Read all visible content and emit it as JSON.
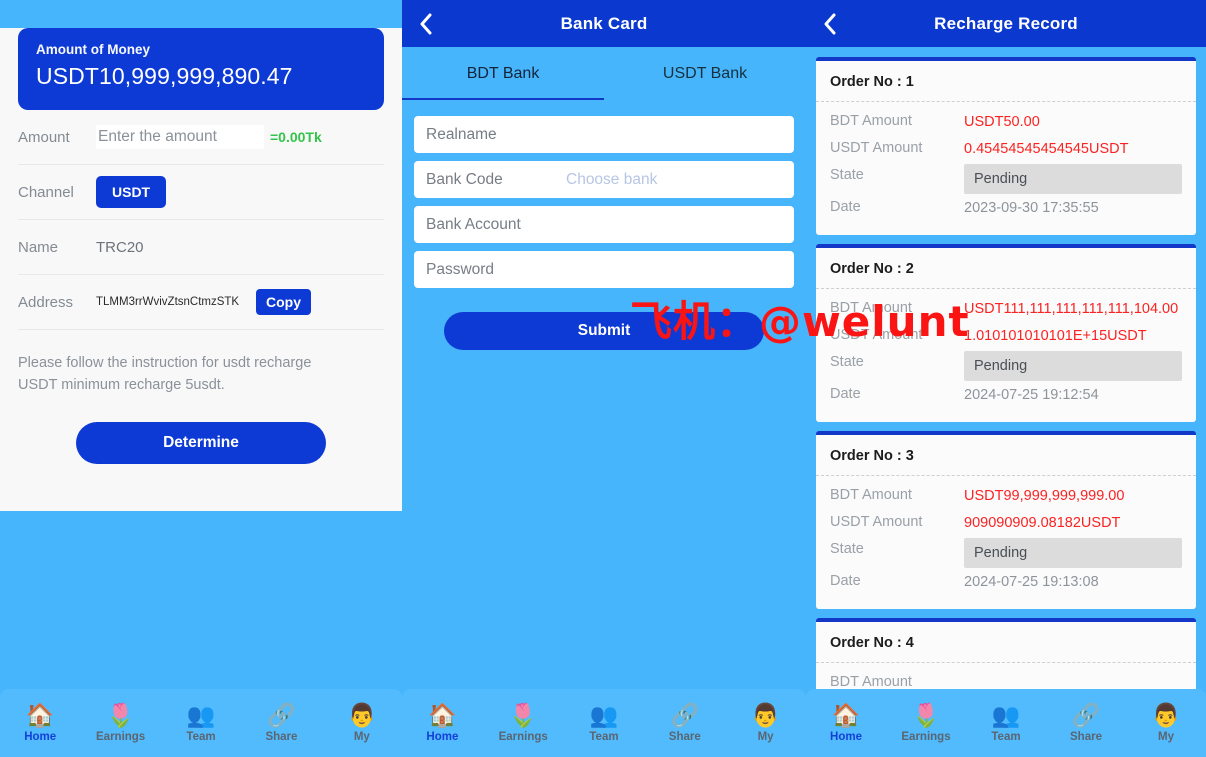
{
  "colors": {
    "brand_blue": "#0d3ad4",
    "light_blue_bg": "#46b5fb",
    "header_blue": "#0b39cf",
    "green_note": "#33c54b",
    "red_amount": "#fb2222",
    "badge_gray": "#dcdcdc",
    "watermark_red": "#fb1414"
  },
  "watermark": {
    "text": "飞机：@welunt"
  },
  "panel1": {
    "balance": {
      "label": "Amount of Money",
      "value": "USDT10,999,999,890.47"
    },
    "rows": {
      "amount_label": "Amount",
      "amount_placeholder": "Enter the amount",
      "amount_value": "",
      "tk_note": "=0.00Tk",
      "channel_label": "Channel",
      "channel_value": "USDT",
      "name_label": "Name",
      "name_value": "TRC20",
      "address_label": "Address",
      "address_value": "TLMM3rrWvivZtsnCtmzSTK",
      "copy_label": "Copy"
    },
    "note_line1": "Please follow the instruction for usdt recharge",
    "note_line2": "USDT minimum recharge 5usdt.",
    "determine_label": "Determine"
  },
  "panel2": {
    "title": "Bank Card",
    "back_icon": "chevron-left-icon",
    "tabs": [
      {
        "label": "BDT Bank",
        "active": true
      },
      {
        "label": "USDT Bank",
        "active": false
      }
    ],
    "fields": {
      "realname_placeholder": "Realname",
      "realname_value": "",
      "bankcode_label": "Bank Code",
      "bankcode_placeholder": "Choose bank",
      "bankaccount_placeholder": "Bank Account",
      "bankaccount_value": "",
      "password_placeholder": "Password",
      "password_value": ""
    },
    "submit_label": "Submit"
  },
  "panel3": {
    "title": "Recharge Record",
    "back_icon": "chevron-left-icon",
    "labels": {
      "bdt": "BDT Amount",
      "usdt": "USDT Amount",
      "state": "State",
      "date": "Date"
    },
    "orders": [
      {
        "head": "Order No : 1",
        "bdt_amount": "USDT50.00",
        "usdt_amount": "0.45454545454545USDT",
        "state": "Pending",
        "date": "2023-09-30 17:35:55"
      },
      {
        "head": "Order No : 2",
        "bdt_amount": "USDT111,111,111,111,111,104.00",
        "usdt_amount": "1.010101010101E+15USDT",
        "state": "Pending",
        "date": "2024-07-25 19:12:54"
      },
      {
        "head": "Order No : 3",
        "bdt_amount": "USDT99,999,999,999.00",
        "usdt_amount": "909090909.08182USDT",
        "state": "Pending",
        "date": "2024-07-25 19:13:08"
      },
      {
        "head": "Order No : 4",
        "bdt_amount": "",
        "usdt_amount": "",
        "state": "",
        "date": ""
      }
    ]
  },
  "tabbar": {
    "items": [
      {
        "label": "Home",
        "icon": "house-icon",
        "glyph": "🏠",
        "active": true
      },
      {
        "label": "Earnings",
        "icon": "money-plant-icon",
        "glyph": "🌷",
        "active": false
      },
      {
        "label": "Team",
        "icon": "people-group-icon",
        "glyph": "👥",
        "active": false
      },
      {
        "label": "Share",
        "icon": "share-nodes-icon",
        "glyph": "🔗",
        "active": false
      },
      {
        "label": "My",
        "icon": "user-profile-icon",
        "glyph": "👨",
        "active": false
      }
    ]
  }
}
